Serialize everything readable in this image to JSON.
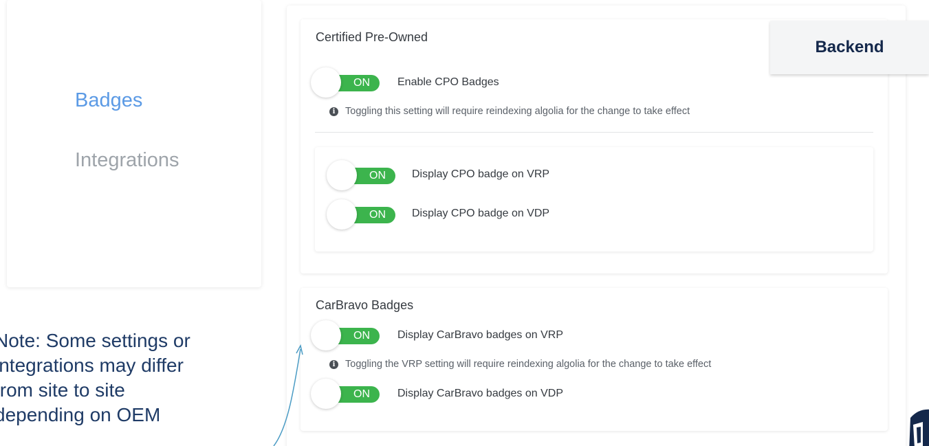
{
  "sidebar": {
    "items": [
      {
        "label": "Badges",
        "active": true
      },
      {
        "label": "Integrations",
        "active": false
      }
    ]
  },
  "note": {
    "lines": [
      "Note: Some settings or",
      "integrations may differ",
      "from site to site",
      "depending on OEM"
    ]
  },
  "callout": {
    "label": "Backend"
  },
  "cpo": {
    "title": "Certified Pre-Owned",
    "enable": {
      "toggle": "ON",
      "label": "Enable CPO Badges"
    },
    "info": "Toggling this setting will require reindexing algolia for the change to take effect",
    "vrp": {
      "toggle": "ON",
      "label": "Display CPO badge on VRP"
    },
    "vdp": {
      "toggle": "ON",
      "label": "Display CPO badge on VDP"
    }
  },
  "carbravo": {
    "title": "CarBravo Badges",
    "vrp": {
      "toggle": "ON",
      "label": "Display CarBravo badges on VRP"
    },
    "info": "Toggling the VRP setting will require reindexing algolia for the change to take effect",
    "vdp": {
      "toggle": "ON",
      "label": "Display CarBravo badges on VDP"
    }
  },
  "colors": {
    "toggle_on": "#3cb44d",
    "nav_active": "#5b9ae5",
    "nav_inactive": "#9ea4aa",
    "note_text": "#1f3b66",
    "arrow": "#4a9bc4"
  },
  "icons": [
    "info-icon",
    "brand-logo-icon",
    "callout-arrow"
  ]
}
